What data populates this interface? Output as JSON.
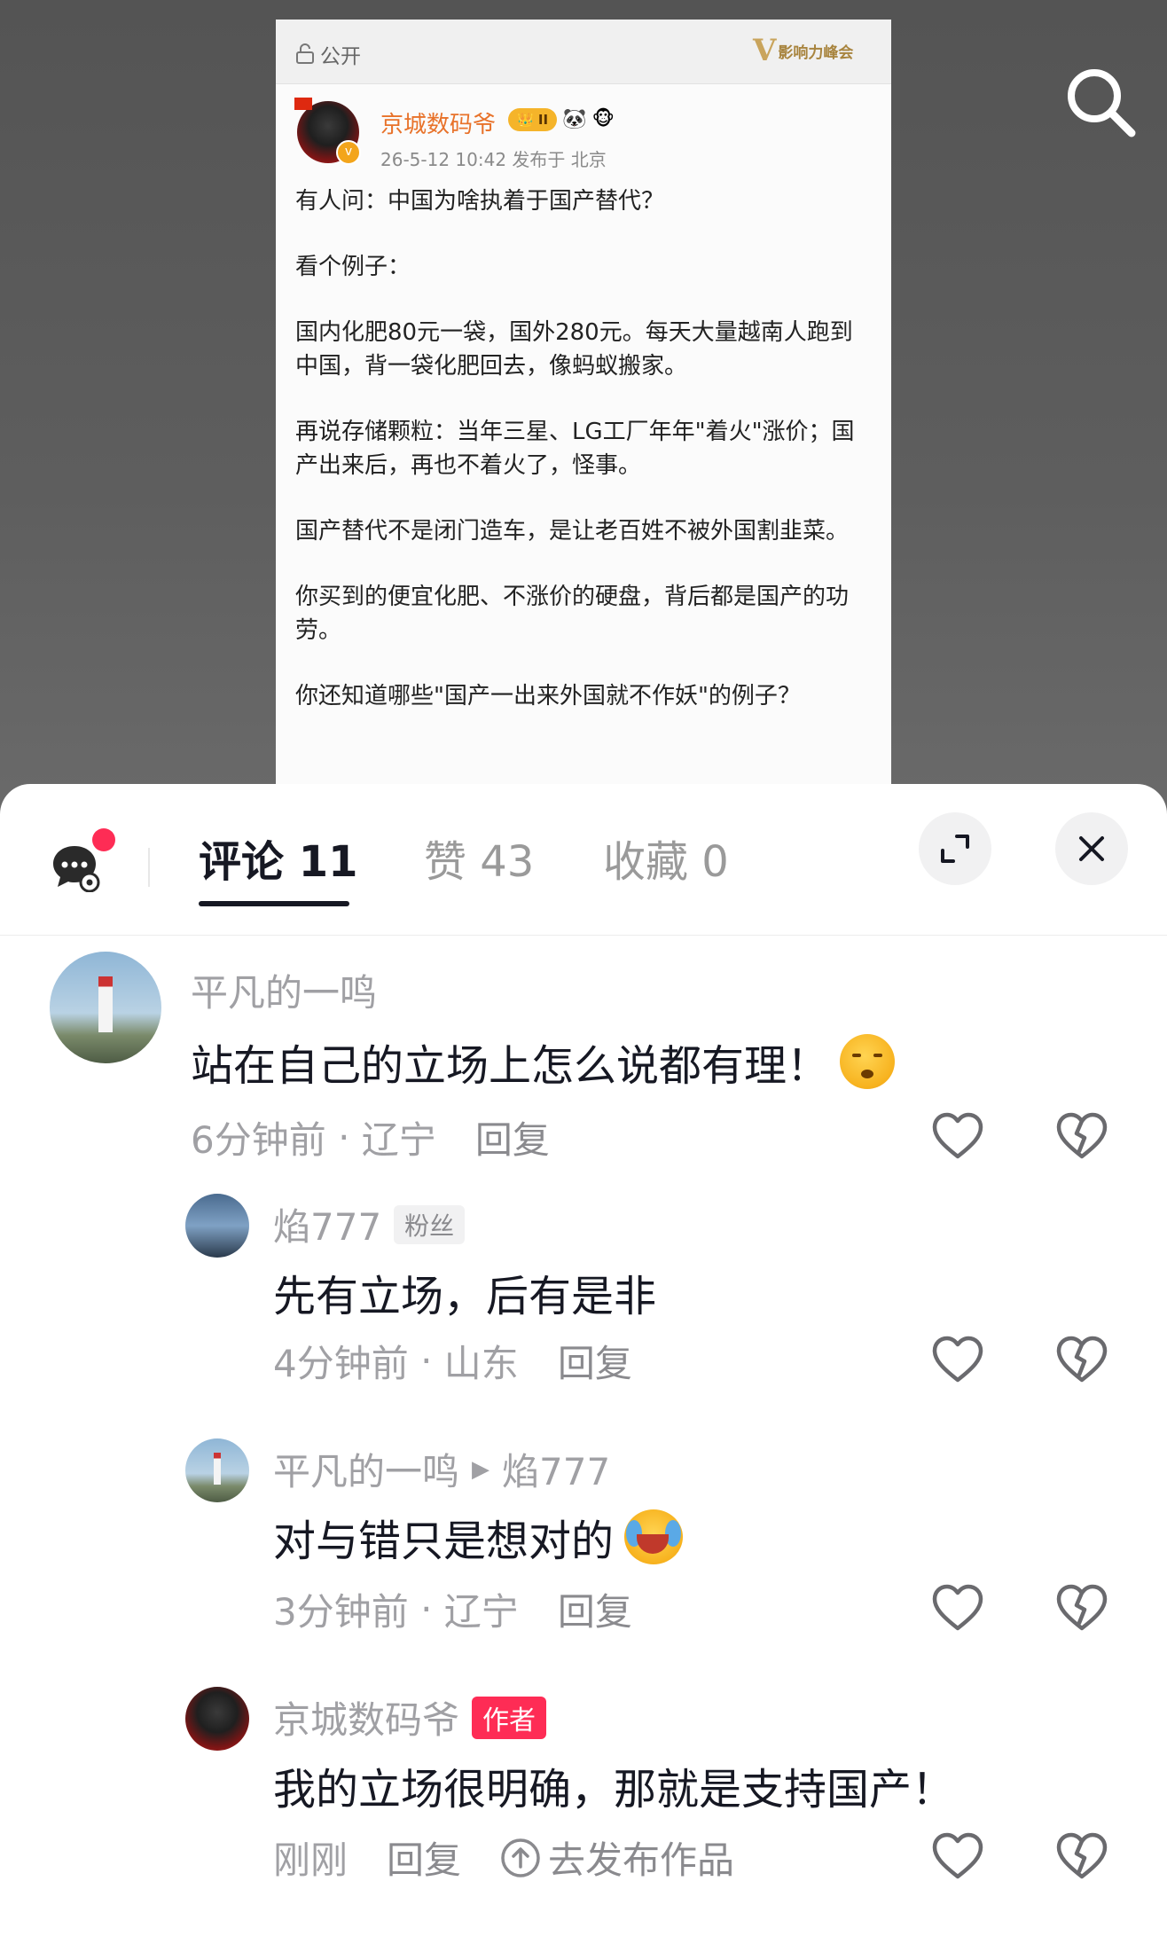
{
  "post": {
    "visibility": "公开",
    "brand": "影响力峰会",
    "author": "京城数码爷",
    "level_badge": "II",
    "meta": "26-5-12 10:42   发布于 北京",
    "paragraphs": [
      "有人问：中国为啥执着于国产替代？",
      "看个例子：",
      "国内化肥80元一袋，国外280元。每天大量越南人跑到中国，背一袋化肥回去，像蚂蚁搬家。",
      "再说存储颗粒：当年三星、LG工厂年年\"着火\"涨价；国产出来后，再也不着火了，怪事。",
      "国产替代不是闭门造车，是让老百姓不被外国割韭菜。",
      "你买到的便宜化肥、不涨价的硬盘，背后都是国产的功劳。",
      "你还知道哪些\"国产一出来外国就不作妖\"的例子？"
    ]
  },
  "sheet": {
    "tabs": [
      {
        "label": "评论 11"
      },
      {
        "label": "赞 43"
      },
      {
        "label": "收藏 0"
      }
    ]
  },
  "comments": [
    {
      "name": "平凡的一鸣",
      "text": "站在自己的立场上怎么说都有理！",
      "time": "6分钟前",
      "location": "辽宁",
      "reply": "回复"
    },
    {
      "name": "焰777",
      "tag": "粉丝",
      "text": "先有立场，后有是非",
      "time": "4分钟前",
      "location": "山东",
      "reply": "回复"
    },
    {
      "name": "平凡的一鸣",
      "reply_to": "焰777",
      "text": "对与错只是想对的",
      "time": "3分钟前",
      "location": "辽宁",
      "reply": "回复"
    },
    {
      "name": "京城数码爷",
      "tag": "作者",
      "text": "我的立场很明确，那就是支持国产！",
      "time": "刚刚",
      "reply": "回复",
      "publish": "去发布作品"
    }
  ],
  "colors": {
    "accent": "#fe2c55",
    "author_name": "#e8722a"
  }
}
